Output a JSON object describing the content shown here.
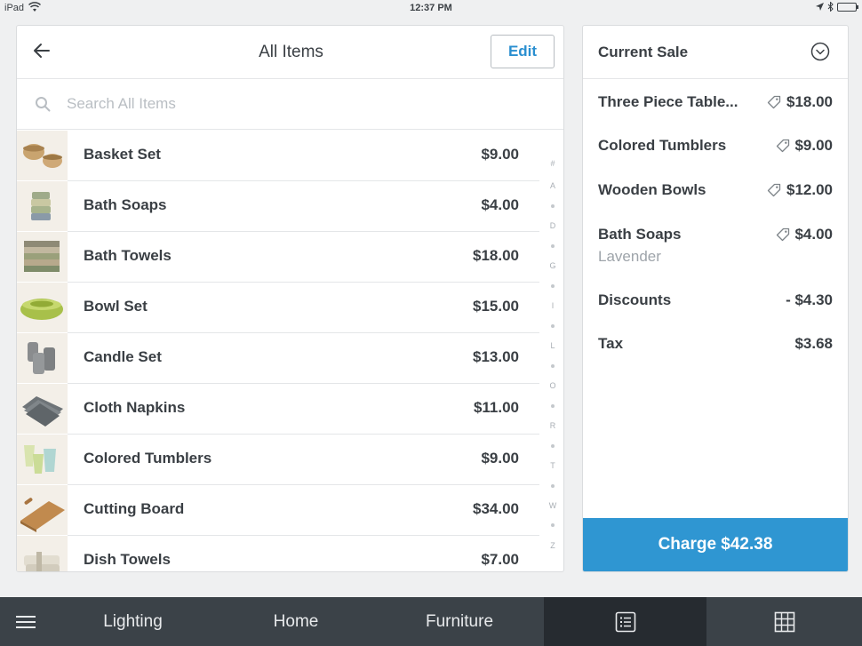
{
  "status_bar": {
    "device": "iPad",
    "time": "12:37 PM"
  },
  "left_panel": {
    "title": "All Items",
    "edit_label": "Edit",
    "search_placeholder": "Search All Items",
    "items": [
      {
        "name": "Basket Set",
        "price": "$9.00"
      },
      {
        "name": "Bath Soaps",
        "price": "$4.00"
      },
      {
        "name": "Bath Towels",
        "price": "$18.00"
      },
      {
        "name": "Bowl Set",
        "price": "$15.00"
      },
      {
        "name": "Candle Set",
        "price": "$13.00"
      },
      {
        "name": "Cloth Napkins",
        "price": "$11.00"
      },
      {
        "name": "Colored Tumblers",
        "price": "$9.00"
      },
      {
        "name": "Cutting Board",
        "price": "$34.00"
      },
      {
        "name": "Dish Towels",
        "price": "$7.00"
      }
    ],
    "alpha_index": [
      "#",
      "A",
      "D",
      "G",
      "I",
      "L",
      "O",
      "R",
      "T",
      "W",
      "Z"
    ]
  },
  "current_sale": {
    "title": "Current Sale",
    "lines": [
      {
        "label": "Three Piece Table...",
        "amount": "$18.00",
        "tag": true
      },
      {
        "label": "Colored Tumblers",
        "amount": "$9.00",
        "tag": true
      },
      {
        "label": "Wooden Bowls",
        "amount": "$12.00",
        "tag": true
      },
      {
        "label": "Bath Soaps",
        "amount": "$4.00",
        "tag": true,
        "variant": "Lavender"
      },
      {
        "label": "Discounts",
        "amount": "- $4.30",
        "tag": false
      },
      {
        "label": "Tax",
        "amount": "$3.68",
        "tag": false
      }
    ],
    "charge_label": "Charge $42.38"
  },
  "bottom_bar": {
    "tabs": [
      "Lighting",
      "Home",
      "Furniture"
    ],
    "icons": [
      "menu-icon",
      "list-view-icon",
      "grid-view-icon"
    ]
  },
  "colors": {
    "accent": "#2f96d2",
    "bottom_bar": "#3b4248",
    "bottom_bar_active": "#262b30"
  }
}
